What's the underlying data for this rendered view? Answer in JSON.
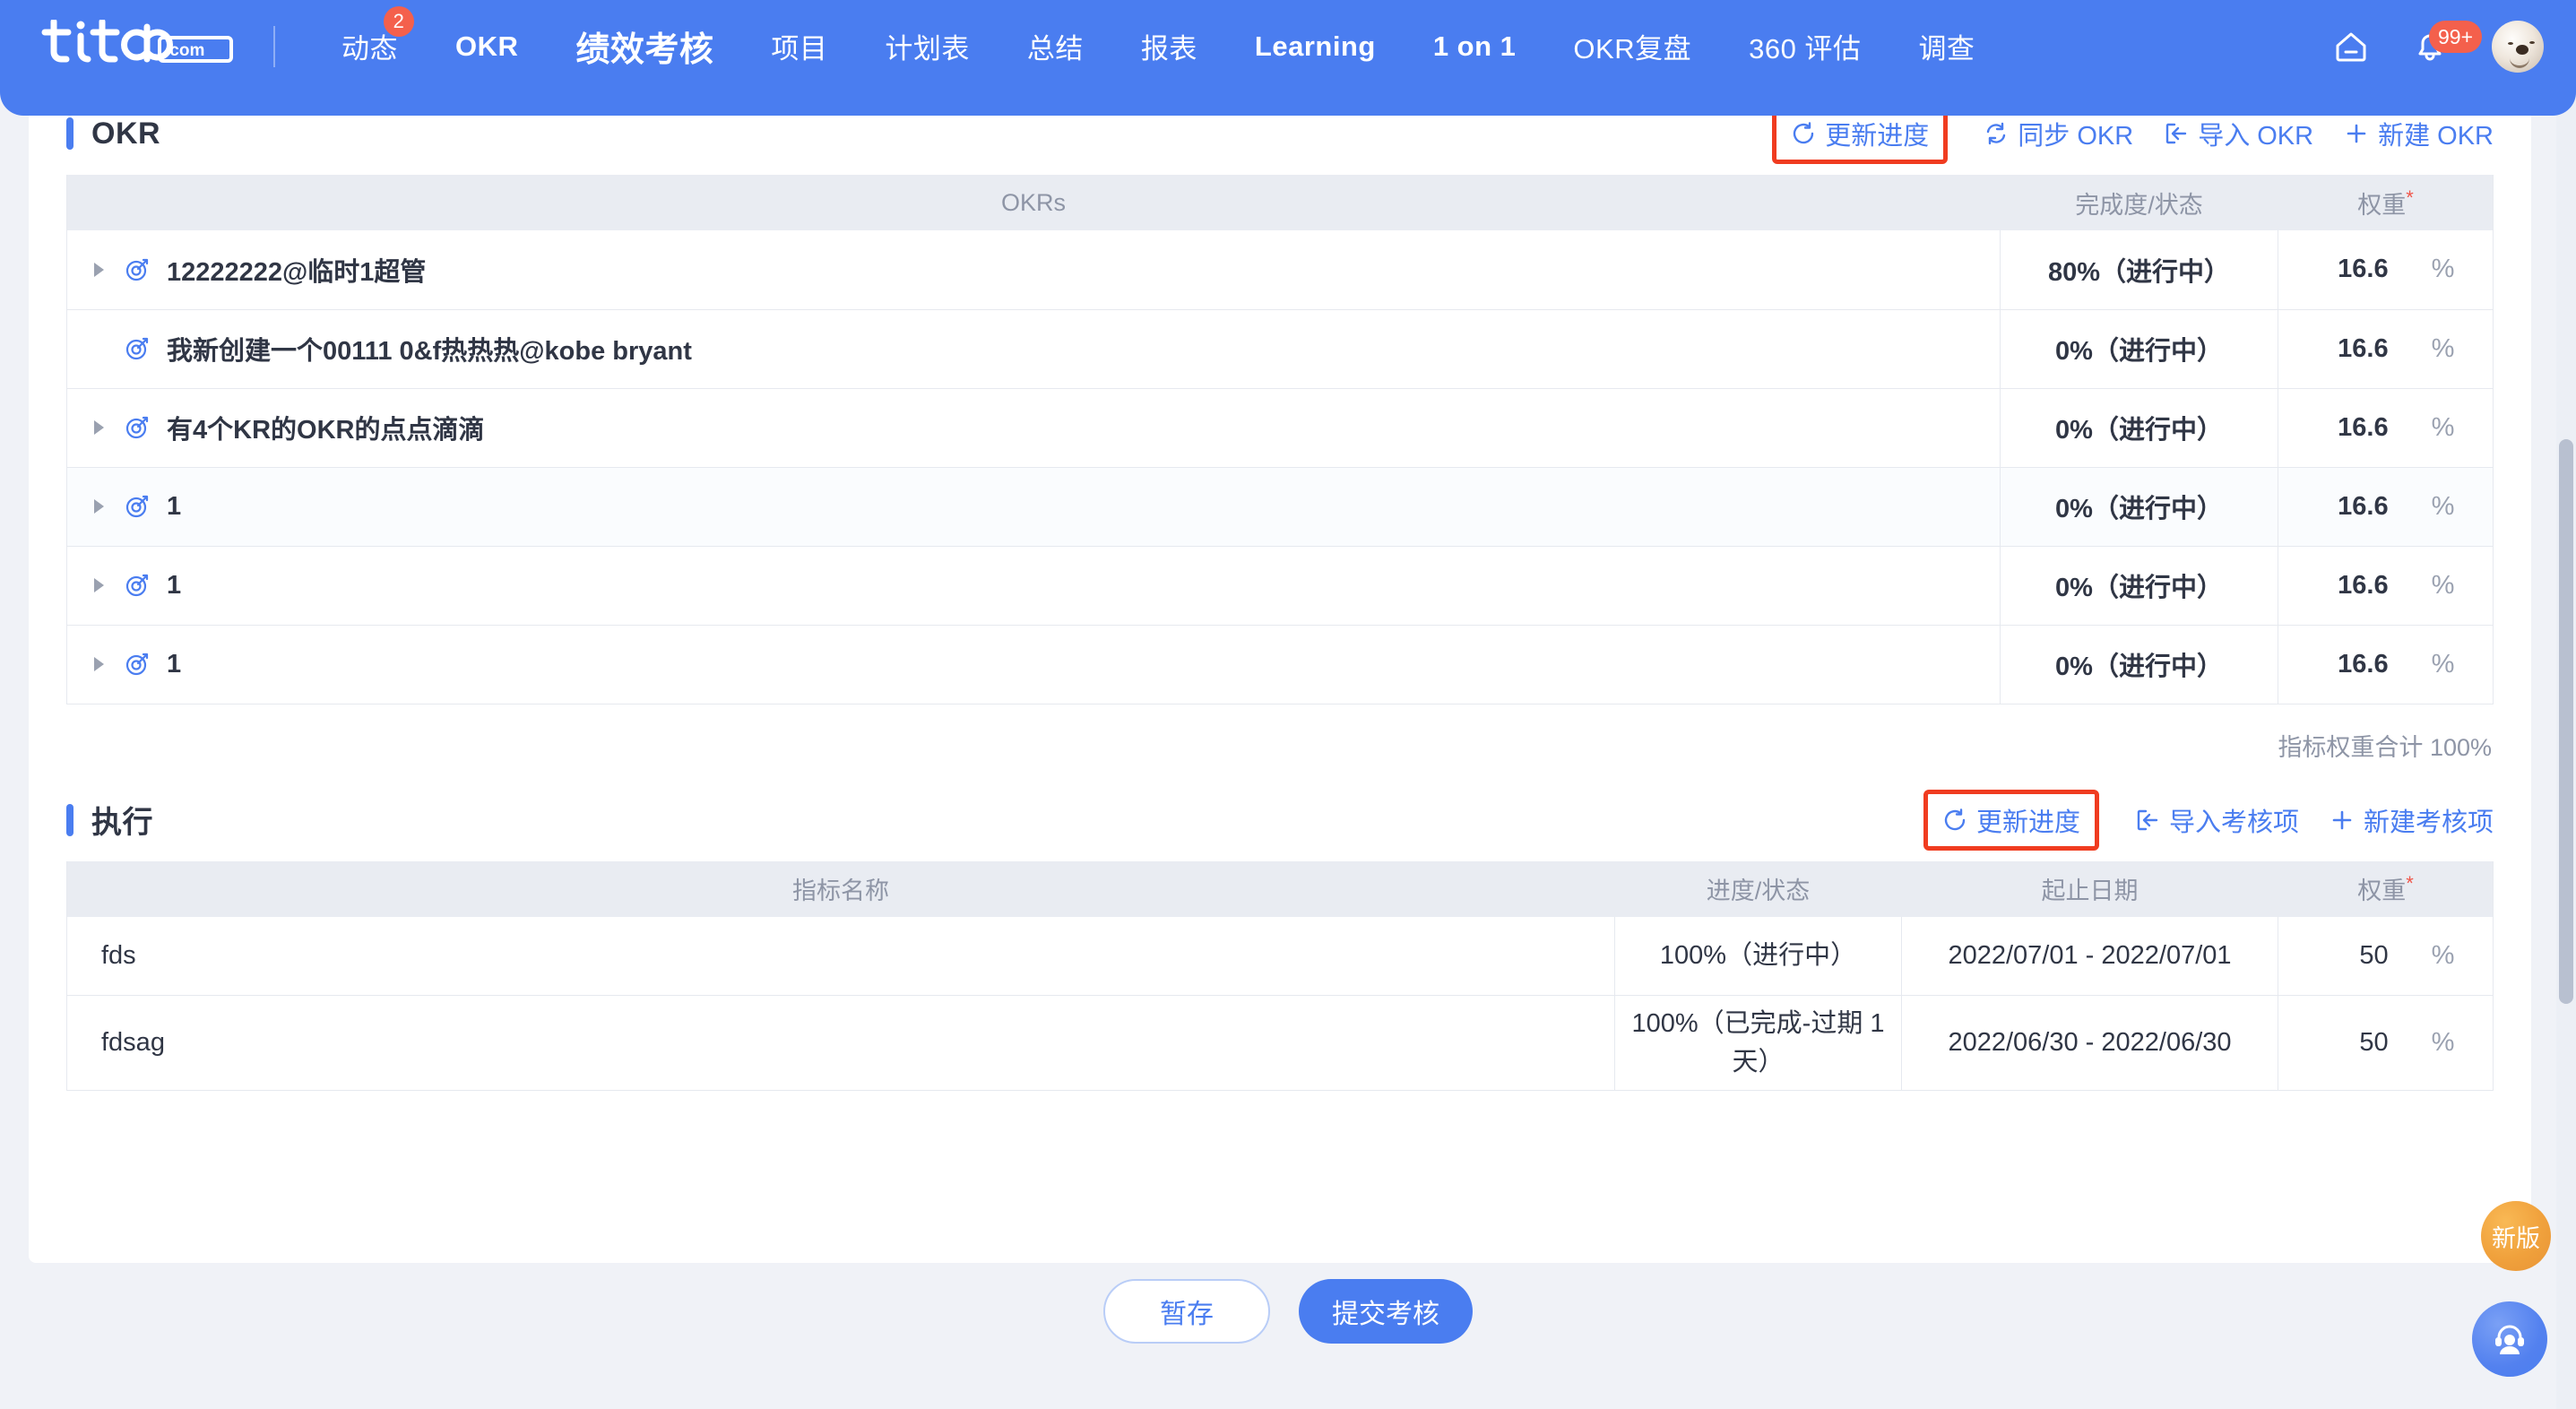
{
  "nav": {
    "logo_text": "tita.com",
    "items": [
      {
        "label": "动态",
        "badge": "2",
        "active": false,
        "en": false
      },
      {
        "label": "OKR",
        "badge": "",
        "active": false,
        "en": true
      },
      {
        "label": "绩效考核",
        "badge": "",
        "active": true,
        "en": false
      },
      {
        "label": "项目",
        "badge": "",
        "active": false,
        "en": false
      },
      {
        "label": "计划表",
        "badge": "",
        "active": false,
        "en": false
      },
      {
        "label": "总结",
        "badge": "",
        "active": false,
        "en": false
      },
      {
        "label": "报表",
        "badge": "",
        "active": false,
        "en": false
      },
      {
        "label": "Learning",
        "badge": "",
        "active": false,
        "en": true
      },
      {
        "label": "1 on 1",
        "badge": "",
        "active": false,
        "en": true
      },
      {
        "label": "OKR复盘",
        "badge": "",
        "active": false,
        "en": false
      },
      {
        "label": "360 评估",
        "badge": "",
        "active": false,
        "en": false
      },
      {
        "label": "调查",
        "badge": "",
        "active": false,
        "en": false
      }
    ],
    "home_icon": "home-icon",
    "bell_icon": "bell-icon",
    "bell_badge": "99+",
    "avatar_alt": "user-avatar"
  },
  "okr_section": {
    "title": "OKR",
    "actions": [
      {
        "label": "更新进度",
        "icon": "refresh-icon",
        "highlighted": true
      },
      {
        "label": "同步 OKR",
        "icon": "sync-icon",
        "highlighted": false
      },
      {
        "label": "导入 OKR",
        "icon": "import-icon",
        "highlighted": false
      },
      {
        "label": "新建 OKR",
        "icon": "plus-icon",
        "highlighted": false
      }
    ],
    "columns": [
      "OKRs",
      "完成度/状态",
      "权重*"
    ],
    "weight_required_mark": "*",
    "rows": [
      {
        "title": "12222222@临时1超管",
        "expandable": true,
        "progress": "80%（进行中）",
        "weight": "16.6",
        "unit": "%",
        "hover": false
      },
      {
        "title": "我新创建一个00111 0&f热热热@kobe bryant",
        "expandable": false,
        "progress": "0%（进行中）",
        "weight": "16.6",
        "unit": "%",
        "hover": false
      },
      {
        "title": "有4个KR的OKR的点点滴滴",
        "expandable": true,
        "progress": "0%（进行中）",
        "weight": "16.6",
        "unit": "%",
        "hover": false
      },
      {
        "title": "1",
        "expandable": true,
        "progress": "0%（进行中）",
        "weight": "16.6",
        "unit": "%",
        "hover": true
      },
      {
        "title": "1",
        "expandable": true,
        "progress": "0%（进行中）",
        "weight": "16.6",
        "unit": "%",
        "hover": false
      },
      {
        "title": "1",
        "expandable": true,
        "progress": "0%（进行中）",
        "weight": "16.6",
        "unit": "%",
        "hover": false
      }
    ],
    "total_text": "指标权重合计 100%"
  },
  "exec_section": {
    "title": "执行",
    "actions": [
      {
        "label": "更新进度",
        "icon": "refresh-icon",
        "highlighted": true
      },
      {
        "label": "导入考核项",
        "icon": "import-icon",
        "highlighted": false
      },
      {
        "label": "新建考核项",
        "icon": "plus-icon",
        "highlighted": false
      }
    ],
    "columns": [
      "指标名称",
      "进度/状态",
      "起止日期",
      "权重*"
    ],
    "rows": [
      {
        "name": "fds",
        "progress": "100%（进行中）",
        "dates": "2022/07/01 - 2022/07/01",
        "weight": "50",
        "unit": "%"
      },
      {
        "name": "fdsag",
        "progress": "100%（已完成-过期 1天）",
        "dates": "2022/06/30 - 2022/06/30",
        "weight": "50",
        "unit": "%"
      }
    ]
  },
  "footer": {
    "save_label": "暂存",
    "submit_label": "提交考核"
  },
  "floaters": {
    "new_version_label": "新版",
    "support_icon": "headset-support-icon"
  },
  "colors": {
    "brand_blue": "#4a7df0",
    "highlight_red": "#f03c20",
    "badge_red": "#f4604c",
    "page_bg": "#f0f2f7",
    "header_bg": "#e9ecf2",
    "text_dark": "#303645",
    "text_muted": "#8e95a6",
    "new_version_orange": "#f0a13c"
  }
}
